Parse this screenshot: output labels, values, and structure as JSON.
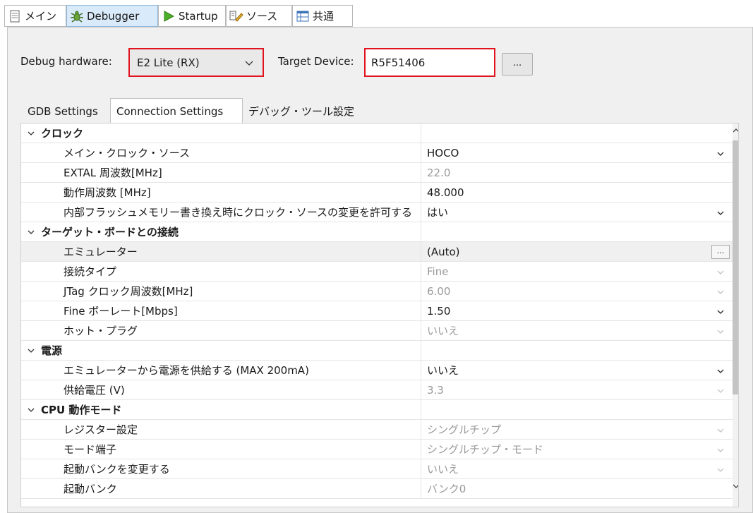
{
  "top_tabs": [
    {
      "label": "メイン",
      "icon": "document-icon",
      "active": false
    },
    {
      "label": "Debugger",
      "icon": "bug-icon",
      "active": true
    },
    {
      "label": "Startup",
      "icon": "play-icon",
      "active": false
    },
    {
      "label": "ソース",
      "icon": "source-icon",
      "active": false
    },
    {
      "label": "共通",
      "icon": "window-icon",
      "active": false
    }
  ],
  "debug_hardware": {
    "label": "Debug hardware:",
    "value": "E2 Lite (RX)"
  },
  "target_device": {
    "label": "Target Device:",
    "value": "R5F51406",
    "browse_label": "..."
  },
  "sub_tabs": [
    "GDB Settings",
    "Connection Settings",
    "デバッグ・ツール設定"
  ],
  "active_sub_tab": "Connection Settings",
  "rows": [
    {
      "type": "category",
      "name": "クロック"
    },
    {
      "type": "prop",
      "name": "メイン・クロック・ソース",
      "value": "HOCO",
      "enabled": true,
      "dropdown": true
    },
    {
      "type": "prop",
      "name": "EXTAL 周波数[MHz]",
      "value": "22.0",
      "enabled": false,
      "dropdown": false
    },
    {
      "type": "prop",
      "name": "動作周波数 [MHz]",
      "value": "48.000",
      "enabled": true,
      "dropdown": false
    },
    {
      "type": "prop",
      "name": "内部フラッシュメモリー書き換え時にクロック・ソースの変更を許可する",
      "value": "はい",
      "enabled": true,
      "dropdown": true
    },
    {
      "type": "category",
      "name": "ターゲット・ボードとの接続"
    },
    {
      "type": "prop",
      "name": "エミュレーター",
      "value": "(Auto)",
      "enabled": true,
      "button": "...",
      "shaded": true
    },
    {
      "type": "prop",
      "name": "接続タイプ",
      "value": "Fine",
      "enabled": false,
      "dropdown": true
    },
    {
      "type": "prop",
      "name": "JTag クロック周波数[MHz]",
      "value": "6.00",
      "enabled": false,
      "dropdown": true
    },
    {
      "type": "prop",
      "name": "Fine ボーレート[Mbps]",
      "value": "1.50",
      "enabled": true,
      "dropdown": true
    },
    {
      "type": "prop",
      "name": "ホット・プラグ",
      "value": "いいえ",
      "enabled": false,
      "dropdown": true
    },
    {
      "type": "category",
      "name": "電源"
    },
    {
      "type": "prop",
      "name": "エミュレーターから電源を供給する (MAX 200mA)",
      "value": "いいえ",
      "enabled": true,
      "dropdown": true
    },
    {
      "type": "prop",
      "name": "供給電圧 (V)",
      "value": "3.3",
      "enabled": false,
      "dropdown": true
    },
    {
      "type": "category",
      "name": "CPU 動作モード"
    },
    {
      "type": "prop",
      "name": "レジスター設定",
      "value": "シングルチップ",
      "enabled": false,
      "dropdown": true
    },
    {
      "type": "prop",
      "name": "モード端子",
      "value": "シングルチップ・モード",
      "enabled": false,
      "dropdown": true
    },
    {
      "type": "prop",
      "name": "起動バンクを変更する",
      "value": "いいえ",
      "enabled": false,
      "dropdown": true
    },
    {
      "type": "prop",
      "name": "起動バンク",
      "value": "バンク0",
      "enabled": false,
      "dropdown": false
    }
  ],
  "icons": {
    "expand": "chevron-down-icon",
    "dropdown": "chevron-down-icon",
    "scroll_up": "chevron-up-icon",
    "scroll_down": "chevron-down-icon"
  }
}
